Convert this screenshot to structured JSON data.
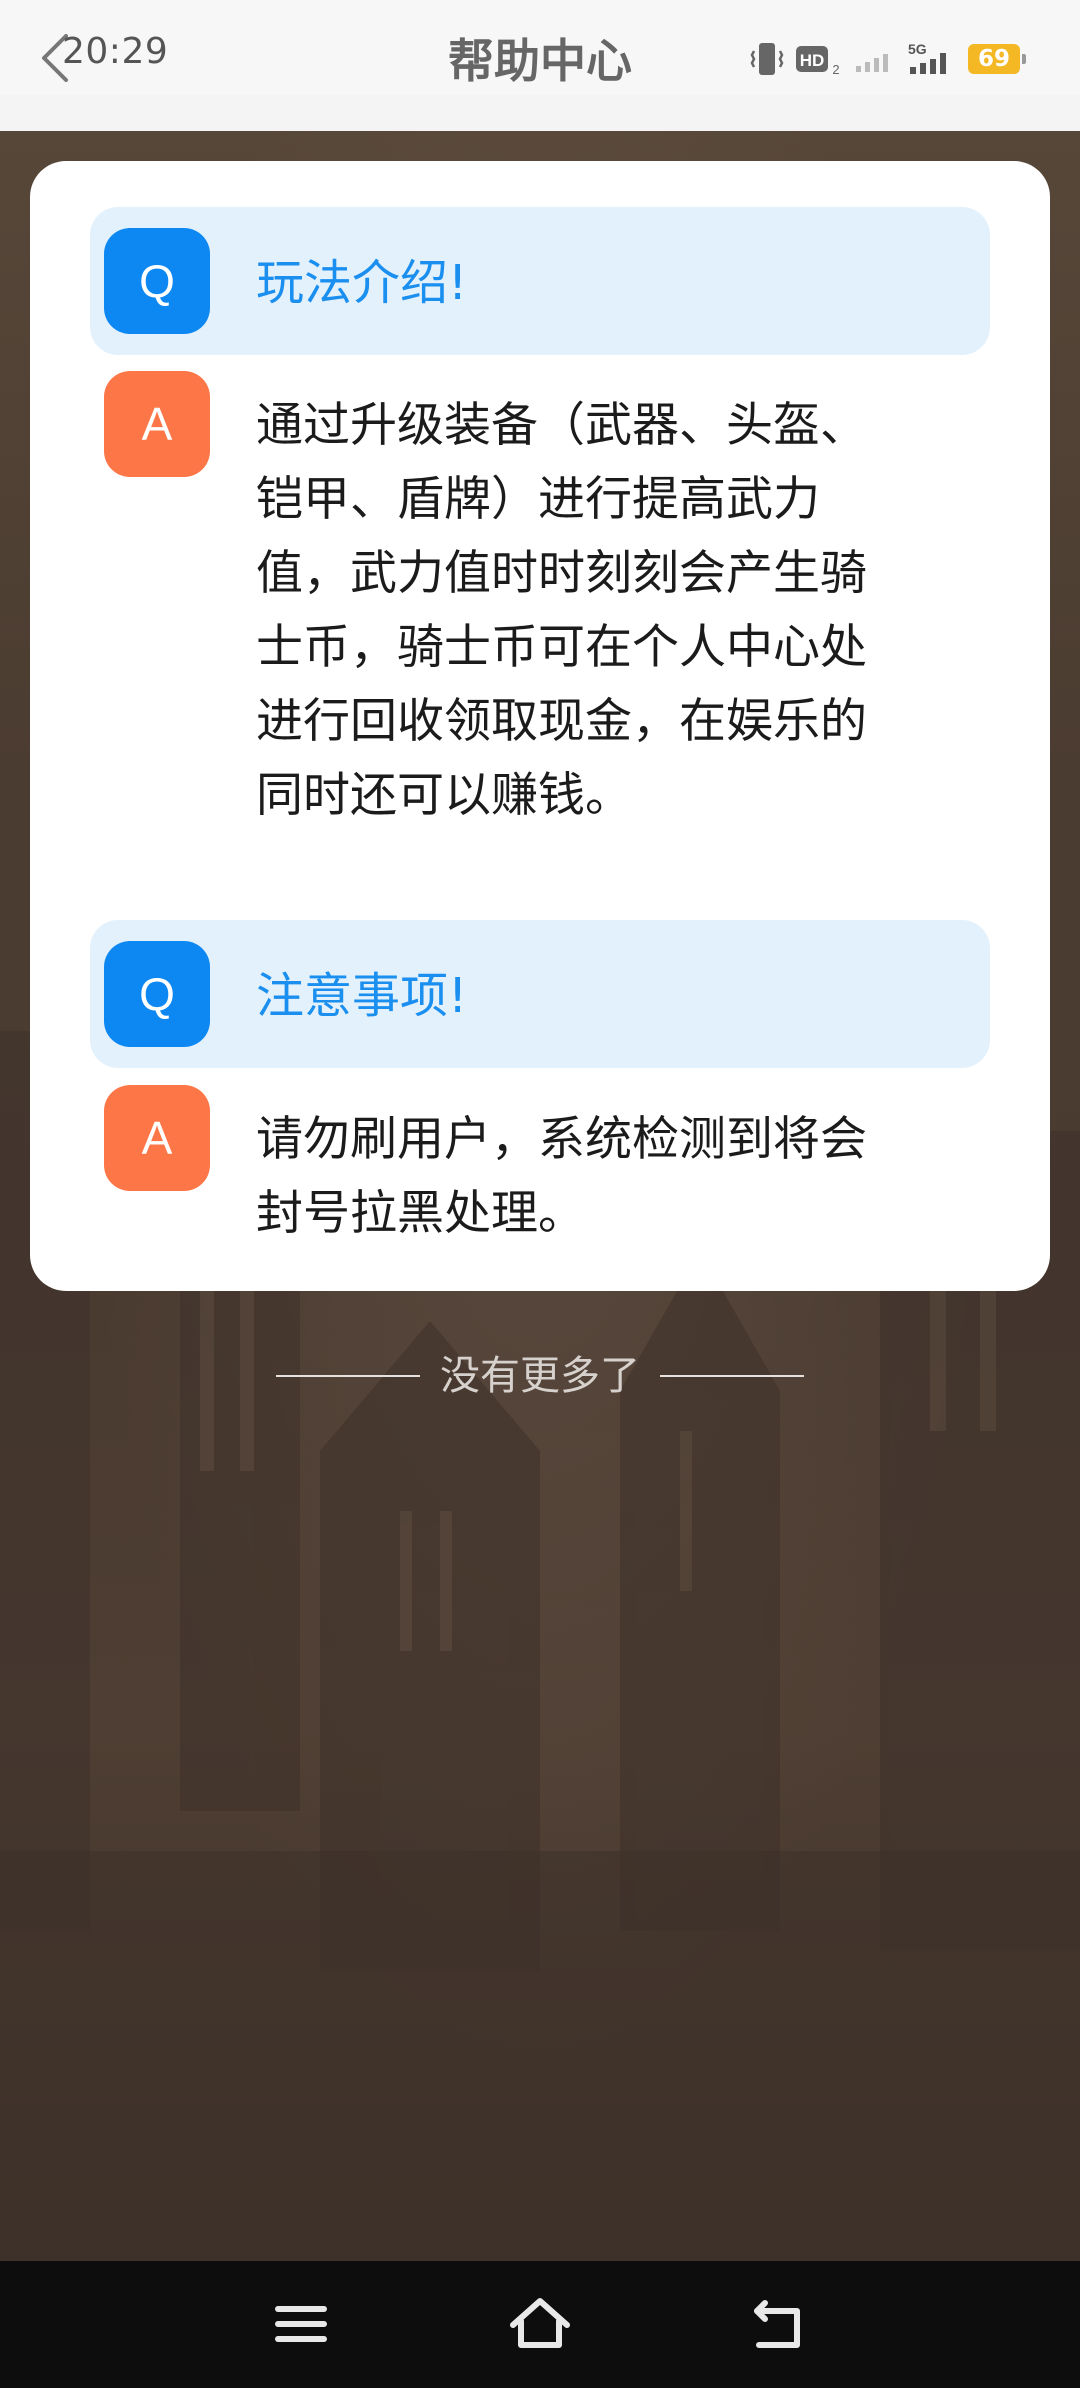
{
  "status_bar": {
    "time": "20:29",
    "network_label": "5G",
    "hd_label": "HD",
    "battery_level": "69"
  },
  "header": {
    "title": "帮助中心"
  },
  "faq": [
    {
      "q_badge": "Q",
      "question": "玩法介绍!",
      "a_badge": "A",
      "answer_lines": [
        "通过升级装备（武器、头盔、",
        "铠甲、盾牌）进行提高武力",
        "值，武力值时时刻刻会产生骑",
        "士币，骑士币可在个人中心处",
        "进行回收领取现金，在娱乐的",
        "同时还可以赚钱。"
      ]
    },
    {
      "q_badge": "Q",
      "question": "注意事项!",
      "a_badge": "A",
      "answer_lines": [
        "请勿刷用户，系统检测到将会",
        "封号拉黑处理。"
      ]
    }
  ],
  "list_end": {
    "text": "没有更多了"
  },
  "nav": {
    "icons": [
      "menu-icon",
      "home-icon",
      "back-icon"
    ]
  },
  "colors": {
    "q_badge": "#0d88f2",
    "a_badge": "#fd7647",
    "question_text": "#1a8fef",
    "question_bg": "#e3f1fc",
    "battery": "#f3b823"
  }
}
